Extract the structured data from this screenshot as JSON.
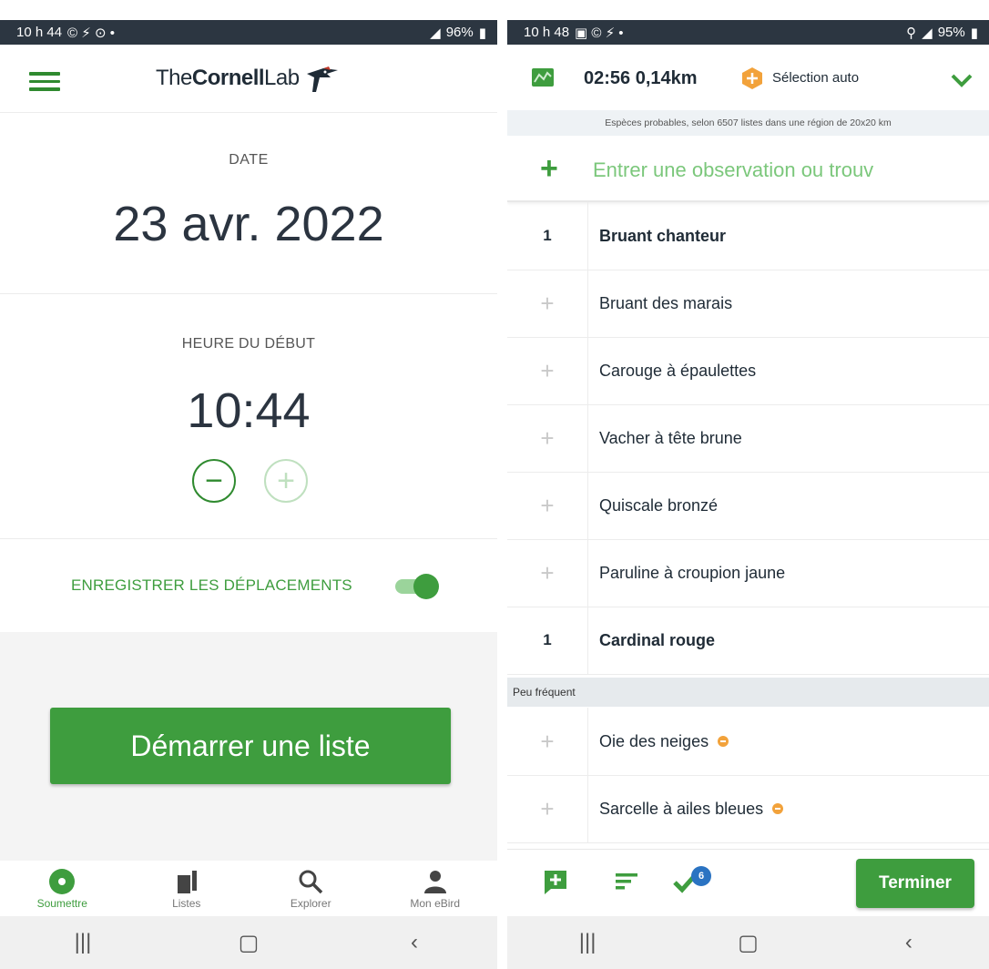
{
  "left": {
    "status": {
      "time": "10 h 44",
      "battery": "96%"
    },
    "header": {
      "logo_the": "The",
      "logo_cornell": "Cornell",
      "logo_lab": "Lab"
    },
    "date_label": "DATE",
    "date_value": "23 avr. 2022",
    "time_label": "HEURE DU DÉBUT",
    "time_value": "10:44",
    "minus_label": "−",
    "plus_label": "+",
    "track_label": "ENREGISTRER LES DÉPLACEMENTS",
    "track_enabled": true,
    "start_button": "Démarrer une liste",
    "tabs": [
      {
        "label": "Soumettre",
        "icon": "submit-icon",
        "active": true
      },
      {
        "label": "Listes",
        "icon": "lists-icon",
        "active": false
      },
      {
        "label": "Explorer",
        "icon": "search-icon",
        "active": false
      },
      {
        "label": "Mon eBird",
        "icon": "person-icon",
        "active": false
      }
    ]
  },
  "right": {
    "status": {
      "time": "10 h 48",
      "battery": "95%"
    },
    "header": {
      "timer": "02:56 0,14km",
      "auto_label": "Sélection auto"
    },
    "info": "Espèces probables, selon 6507 listes dans une région de 20x20 km",
    "entry_placeholder": "Entrer une observation ou trouv",
    "species": [
      {
        "count": "1",
        "name": "Bruant chanteur",
        "bold": true,
        "rare": false
      },
      {
        "count": "+",
        "name": "Bruant des marais",
        "bold": false,
        "rare": false
      },
      {
        "count": "+",
        "name": "Carouge à épaulettes",
        "bold": false,
        "rare": false
      },
      {
        "count": "+",
        "name": "Vacher à tête brune",
        "bold": false,
        "rare": false
      },
      {
        "count": "+",
        "name": "Quiscale bronzé",
        "bold": false,
        "rare": false
      },
      {
        "count": "+",
        "name": "Paruline à croupion jaune",
        "bold": false,
        "rare": false
      },
      {
        "count": "1",
        "name": "Cardinal rouge",
        "bold": true,
        "rare": false
      }
    ],
    "section_label": "Peu fréquent",
    "rare_species": [
      {
        "count": "+",
        "name": "Oie des neiges",
        "bold": false,
        "rare": true
      },
      {
        "count": "+",
        "name": "Sarcelle à ailes bleues",
        "bold": false,
        "rare": true
      }
    ],
    "checked_badge": "6",
    "finish_button": "Terminer"
  },
  "colors": {
    "accent": "#3e9d3e",
    "statusbar": "#2c3641",
    "rare": "#f2a23b",
    "badge": "#2a73c2"
  }
}
